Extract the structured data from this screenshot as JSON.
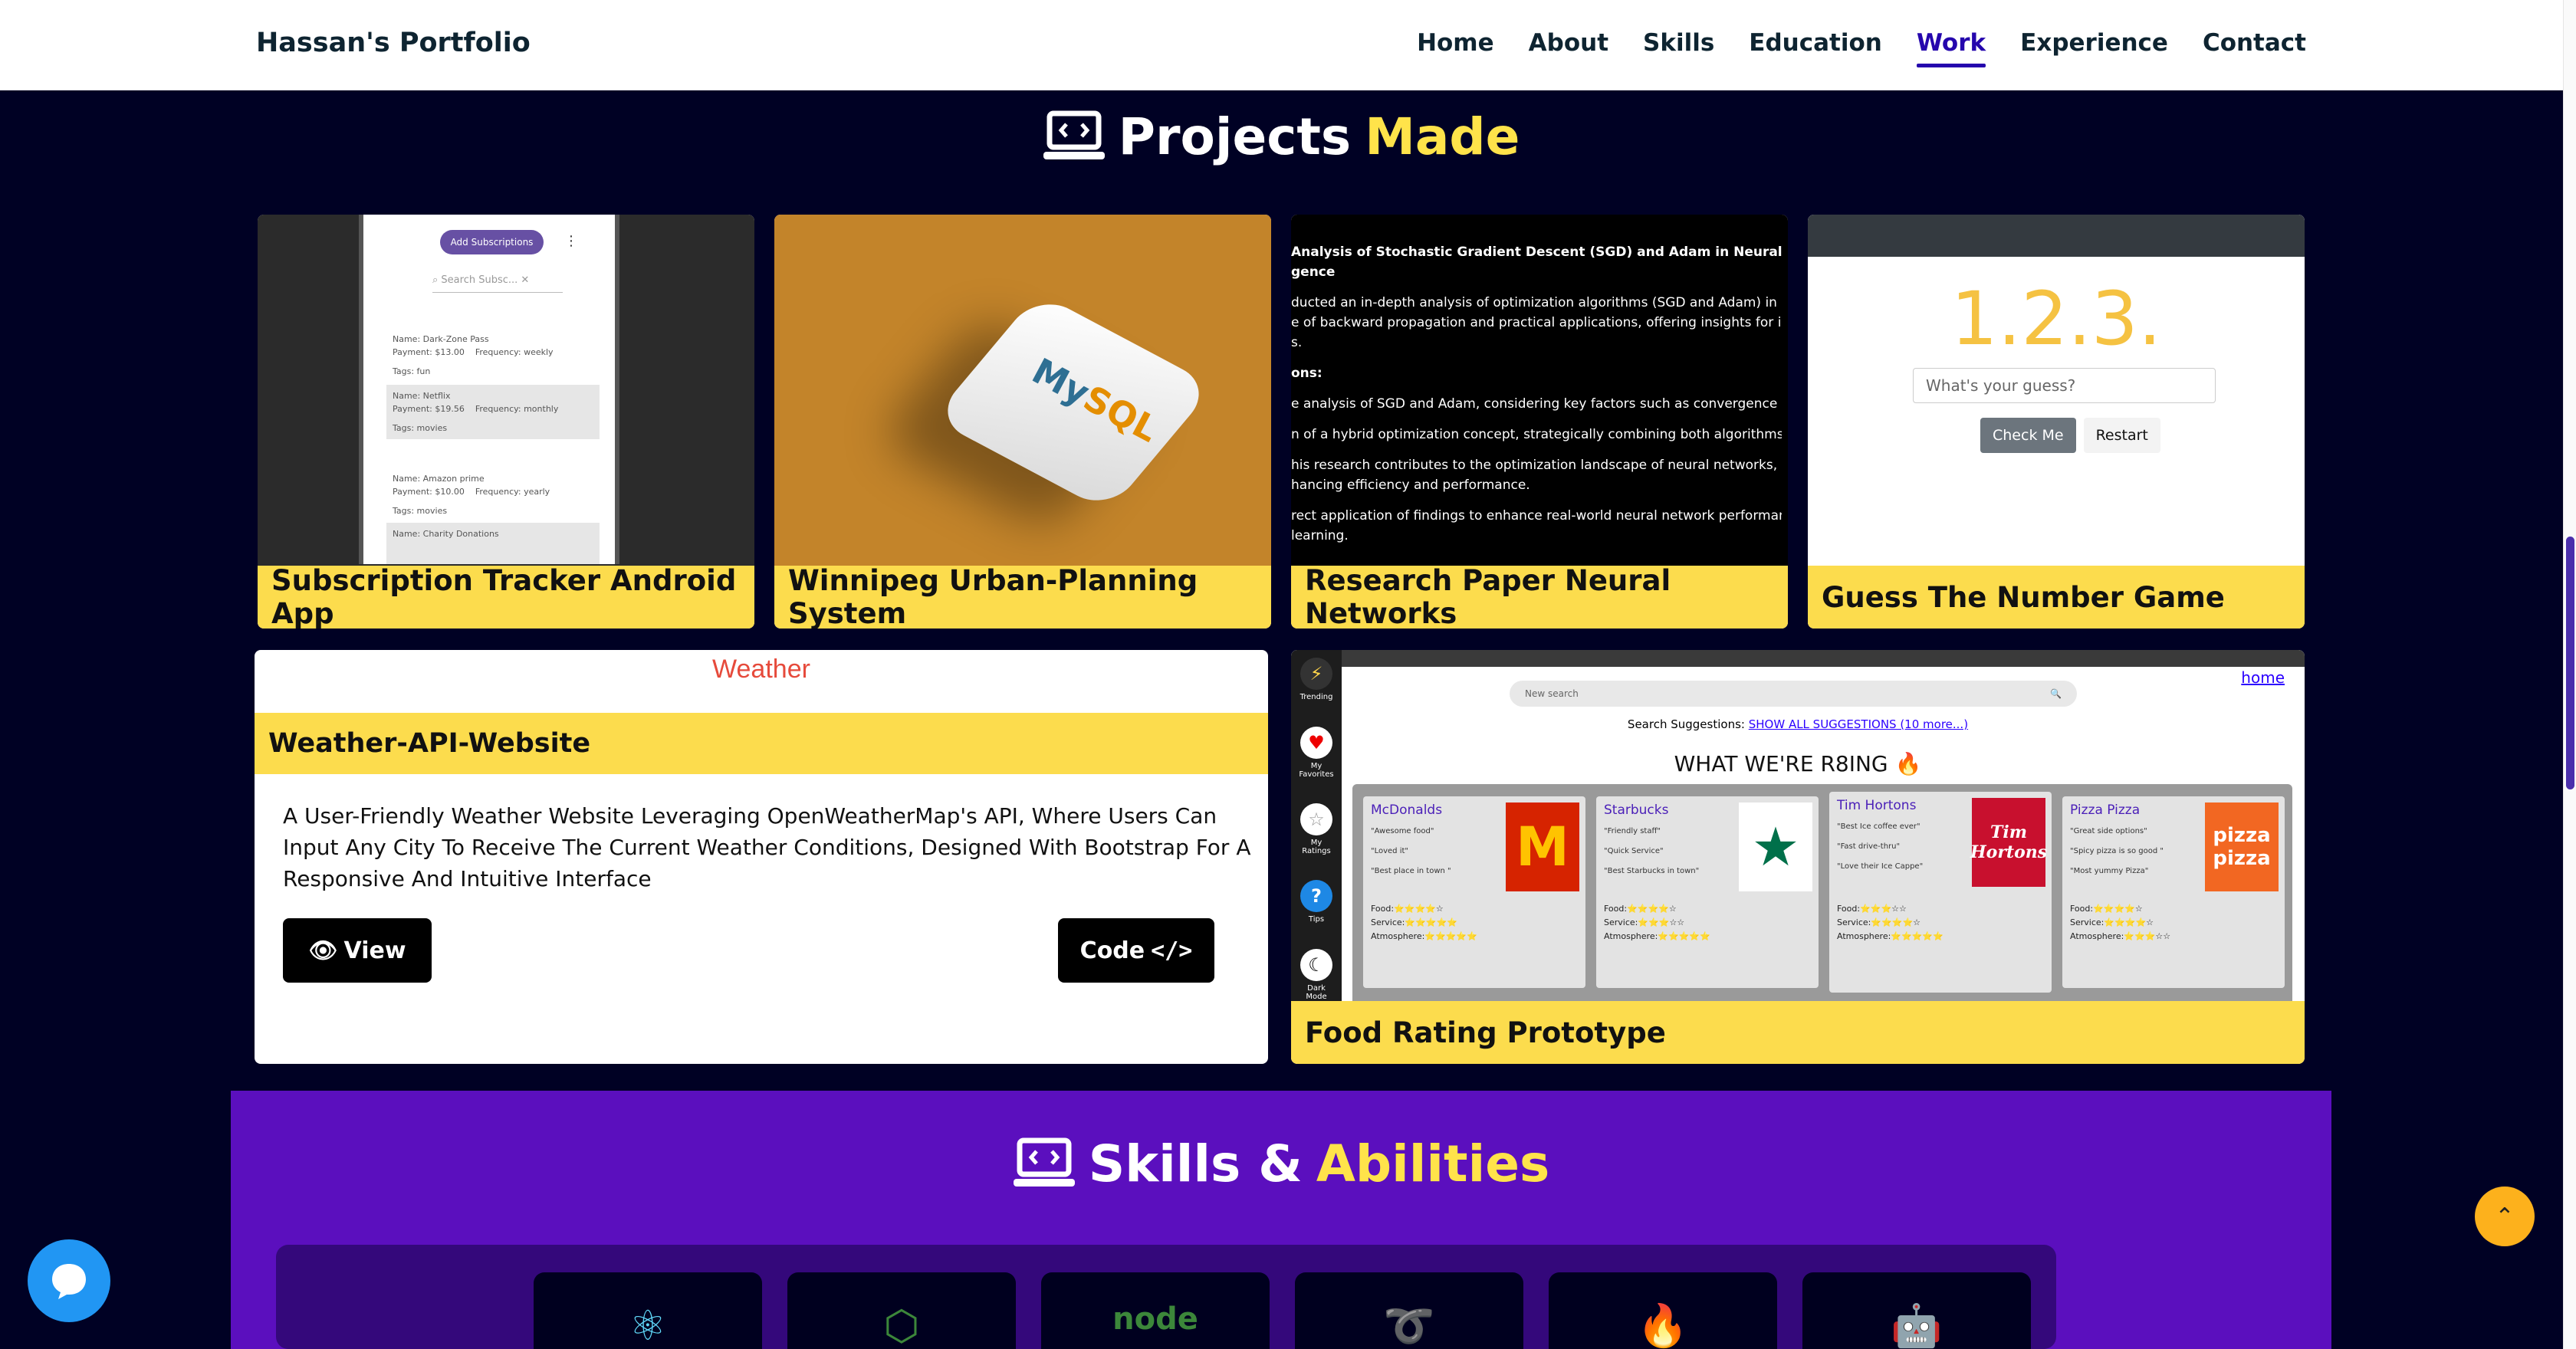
{
  "nav": {
    "brand": "Hassan's Portfolio",
    "links": [
      {
        "label": "Home"
      },
      {
        "label": "About"
      },
      {
        "label": "Skills"
      },
      {
        "label": "Education"
      },
      {
        "label": "Work"
      },
      {
        "label": "Experience"
      },
      {
        "label": "Contact"
      }
    ],
    "active": "Work"
  },
  "projects": {
    "heading_main": "Projects",
    "heading_accent": "Made",
    "cards": [
      {
        "title": "Subscription Tracker Android App"
      },
      {
        "title": "Winnipeg Urban-Planning System"
      },
      {
        "title": "Research Paper Neural Networks"
      },
      {
        "title": "Guess The Number Game"
      }
    ],
    "sub_tracker": {
      "add_label": "Add Subscriptions",
      "search_placeholder": "Search Subsc...",
      "rows": [
        {
          "l1": "Name: Dark-Zone Pass",
          "l2": "Payment: $13.00",
          "freq": "Frequency: weekly",
          "tags": "Tags: fun"
        },
        {
          "l1": "Name: Netflix",
          "l2": "Payment: $19.56",
          "freq": "Frequency: monthly",
          "tags": "Tags: movies"
        },
        {
          "l1": "Name: Amazon prime",
          "l2": "Payment: $10.00",
          "freq": "Frequency: yearly",
          "tags": "Tags: movies"
        },
        {
          "l1": "Name: Charity Donations",
          "l2": "",
          "freq": "",
          "tags": ""
        }
      ]
    },
    "mysql_logo": {
      "my": "My",
      "sql": "SQL"
    },
    "research": {
      "title": "Analysis of Stochastic Gradient Descent (SGD) and Adam in Neural Network Optim",
      "title2": "gence",
      "p1": "ducted an in-depth analysis of optimization algorithms (SGD and Adam) in neural net",
      "p1b": "e of backward propagation and practical applications, offering insights for industry p",
      "p1c": "s.",
      "p2": "ons:",
      "p3": "e analysis of SGD and Adam, considering key factors such as convergence speed ar",
      "p4": "n of a hybrid optimization concept, strategically combining both algorithms.",
      "p5": "his research contributes to the optimization landscape of neural networks, providing",
      "p5b": "hancing efficiency and performance.",
      "p6": "rect application of findings to enhance real-world neural network performance, drivin",
      "p6b": "learning."
    },
    "guess": {
      "number": "1.2.3.",
      "placeholder": "What's your guess?",
      "check": "Check Me",
      "restart": "Restart"
    },
    "weather": {
      "app_title": "Weather",
      "title": "Weather-API-Website",
      "description": "A User-Friendly Weather Website Leveraging OpenWeatherMap's API, Where Users Can Input Any City To Receive The Current Weather Conditions, Designed With Bootstrap For A Responsive And Intuitive Interface",
      "view_label": "View",
      "code_label": "Code"
    },
    "food": {
      "title": "Food Rating Prototype",
      "home": "home",
      "search_placeholder": "New search",
      "suggestions": "Search Suggestions:",
      "suggestions_link": "SHOW ALL SUGGESTIONS (10 more...)",
      "headline": "WHAT WE'RE R8ING 🔥",
      "sidebar": [
        "Trending",
        "My Favorites",
        "My Ratings",
        "Tips",
        "Dark Mode"
      ],
      "restaurants": [
        {
          "name": "McDonalds",
          "quotes": [
            "\"Awesome food\"",
            "\"Loved it\"",
            "\"Best place in town \""
          ],
          "food": "Food:⭐⭐⭐⭐☆",
          "service": "Service:⭐⭐⭐⭐⭐",
          "atmos": "Atmosphere:⭐⭐⭐⭐⭐",
          "logo": "M",
          "logo_bg": "#d62300",
          "logo_fg": "#ffc300"
        },
        {
          "name": "Starbucks",
          "quotes": [
            "\"Friendly staff\"",
            "\"Quick Service\"",
            "\"Best Starbucks in town\""
          ],
          "food": "Food:⭐⭐⭐⭐☆",
          "service": "Service:⭐⭐⭐☆☆",
          "atmos": "Atmosphere:⭐⭐⭐⭐⭐",
          "logo": "★",
          "logo_bg": "#ffffff",
          "logo_fg": "#00704a"
        },
        {
          "name": "Tim Hortons",
          "quotes": [
            "\"Best Ice coffee ever\"",
            "\"Fast drive-thru\"",
            "\"Love their Ice Cappe\""
          ],
          "food": "Food:⭐⭐⭐☆☆",
          "service": "Service:⭐⭐⭐⭐☆",
          "atmos": "Atmosphere:⭐⭐⭐⭐⭐",
          "logo": "Tim Hortons",
          "logo_bg": "#c8102e",
          "logo_fg": "#ffffff"
        },
        {
          "name": "Pizza Pizza",
          "quotes": [
            "\"Great side options\"",
            "\"Spicy pizza is so good \"",
            "\"Most yummy Pizza\""
          ],
          "food": "Food:⭐⭐⭐⭐☆",
          "service": "Service:⭐⭐⭐⭐☆",
          "atmos": "Atmosphere:⭐⭐⭐☆☆",
          "logo": "pizza pizza",
          "logo_bg": "#f26722",
          "logo_fg": "#ffffff"
        }
      ]
    }
  },
  "skills": {
    "heading_main": "Skills &",
    "heading_accent": "Abilities",
    "tiles": [
      {
        "icon": "react-icon",
        "glyph": "⚛",
        "color": "#61dafb"
      },
      {
        "icon": "nodejs-icon",
        "glyph": "⬡",
        "color": "#3c873a"
      },
      {
        "icon": "node-icon",
        "glyph": "node",
        "color": "#3c873a"
      },
      {
        "icon": "redux-icon",
        "glyph": "➰",
        "color": "#764abc"
      },
      {
        "icon": "firebase-icon",
        "glyph": "🔥",
        "color": "#ffa000"
      },
      {
        "icon": "android-icon",
        "glyph": "🤖",
        "color": "#3ddc84"
      }
    ]
  },
  "colors": {
    "accent": "#ffe34a",
    "active_nav": "#2506ad",
    "tag_bg": "#fcdc4d"
  }
}
